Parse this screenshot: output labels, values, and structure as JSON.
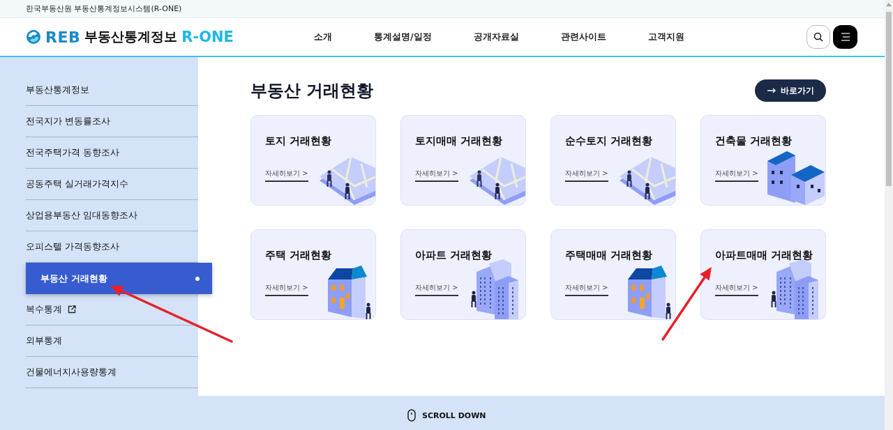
{
  "top_bar": {
    "text": "한국부동산원 부동산통계정보시스템(R-ONE)"
  },
  "header": {
    "logo": {
      "mark": "REB",
      "name": "부동산통계정보",
      "brand": "R-ONE"
    },
    "nav": [
      "소개",
      "통계설명/일정",
      "공개자료실",
      "관련사이트",
      "고객지원"
    ]
  },
  "sidebar": {
    "items": [
      {
        "label": "부동산통계정보",
        "selected": false,
        "external": false
      },
      {
        "label": "전국지가 변동률조사",
        "selected": false,
        "external": false
      },
      {
        "label": "전국주택가격 동향조사",
        "selected": false,
        "external": false
      },
      {
        "label": "공동주택 실거래가격지수",
        "selected": false,
        "external": false
      },
      {
        "label": "상업용부동산 임대동향조사",
        "selected": false,
        "external": false
      },
      {
        "label": "오피스텔 가격동향조사",
        "selected": false,
        "external": false
      },
      {
        "label": "부동산 거래현황",
        "selected": true,
        "external": false
      },
      {
        "label": "복수통계",
        "selected": false,
        "external": true
      },
      {
        "label": "외부통계",
        "selected": false,
        "external": false
      },
      {
        "label": "건물에너지사용량통계",
        "selected": false,
        "external": false
      }
    ]
  },
  "content": {
    "title": "부동산 거래현황",
    "shortcut_button": "바로가기",
    "cards": [
      {
        "title": "토지 거래현황",
        "link": "자세히보기 >",
        "kind": "map"
      },
      {
        "title": "토지매매 거래현황",
        "link": "자세히보기 >",
        "kind": "map"
      },
      {
        "title": "순수토지 거래현황",
        "link": "자세히보기 >",
        "kind": "map"
      },
      {
        "title": "건축물 거래현황",
        "link": "자세히보기 >",
        "kind": "buildings"
      },
      {
        "title": "주택 거래현황",
        "link": "자세히보기 >",
        "kind": "house"
      },
      {
        "title": "아파트 거래현황",
        "link": "자세히보기 >",
        "kind": "apartments"
      },
      {
        "title": "주택매매 거래현황",
        "link": "자세히보기 >",
        "kind": "house"
      },
      {
        "title": "아파트매매 거래현황",
        "link": "자세히보기 >",
        "kind": "apartments"
      }
    ]
  },
  "footer": {
    "scroll_hint": "SCROLL DOWN"
  },
  "annotations": [
    {
      "kind": "arrow",
      "color": "#e8202a"
    },
    {
      "kind": "arrow",
      "color": "#e8202a"
    }
  ]
}
